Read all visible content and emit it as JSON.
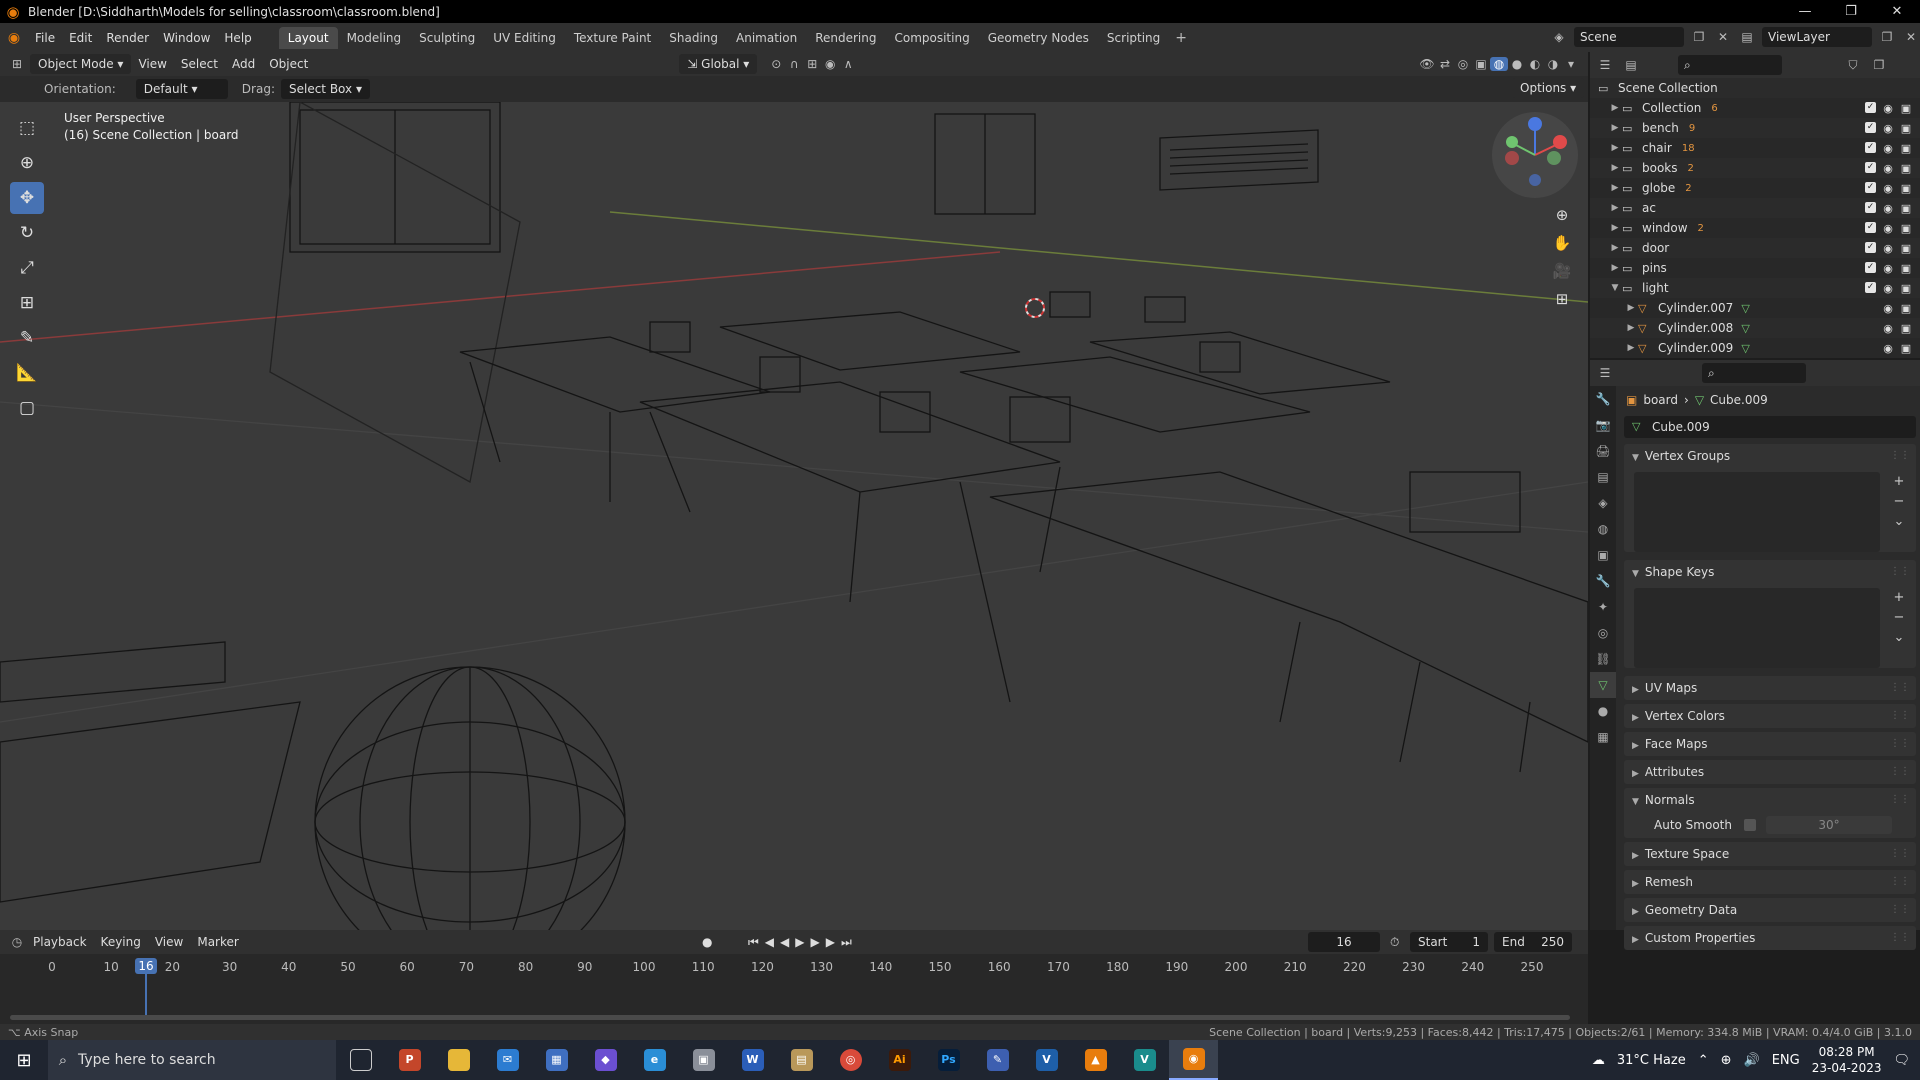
{
  "window": {
    "title": "Blender [D:\\Siddharth\\Models for selling\\classroom\\classroom.blend]"
  },
  "menus": [
    "File",
    "Edit",
    "Render",
    "Window",
    "Help"
  ],
  "workspaces": [
    "Layout",
    "Modeling",
    "Sculpting",
    "UV Editing",
    "Texture Paint",
    "Shading",
    "Animation",
    "Rendering",
    "Compositing",
    "Geometry Nodes",
    "Scripting"
  ],
  "active_workspace": "Layout",
  "scene_name": "Scene",
  "view_layer": "ViewLayer",
  "viewport_header": {
    "mode": "Object Mode",
    "menus": [
      "View",
      "Select",
      "Add",
      "Object"
    ],
    "transform_orientation": "Global"
  },
  "tool_header": {
    "orientation_label": "Orientation:",
    "orientation_value": "Default",
    "drag_label": "Drag:",
    "drag_value": "Select Box",
    "options": "Options"
  },
  "viewport_info": {
    "perspective": "User Perspective",
    "collection": "(16) Scene Collection | board"
  },
  "outliner": {
    "root": "Scene Collection",
    "rows": [
      {
        "label": "Collection",
        "count": "6",
        "type": "collection"
      },
      {
        "label": "bench",
        "count": "9",
        "type": "collection"
      },
      {
        "label": "chair",
        "count": "18",
        "type": "collection"
      },
      {
        "label": "books",
        "count": "2",
        "type": "collection"
      },
      {
        "label": "globe",
        "count": "2",
        "type": "collection"
      },
      {
        "label": "ac",
        "count": "",
        "type": "collection"
      },
      {
        "label": "window",
        "count": "2",
        "type": "collection"
      },
      {
        "label": "door",
        "count": "",
        "type": "collection"
      },
      {
        "label": "pins",
        "count": "",
        "type": "collection"
      },
      {
        "label": "light",
        "count": "",
        "type": "collection"
      },
      {
        "label": "Cylinder.007",
        "count": "",
        "type": "mesh"
      },
      {
        "label": "Cylinder.008",
        "count": "",
        "type": "mesh"
      },
      {
        "label": "Cylinder.009",
        "count": "",
        "type": "mesh"
      }
    ]
  },
  "properties": {
    "breadcrumb_object": "board",
    "breadcrumb_mesh": "Cube.009",
    "mesh_name": "Cube.009",
    "panels": {
      "vertex_groups": "Vertex Groups",
      "shape_keys": "Shape Keys",
      "uv_maps": "UV Maps",
      "vertex_colors": "Vertex Colors",
      "face_maps": "Face Maps",
      "attributes": "Attributes",
      "normals": "Normals",
      "texture_space": "Texture Space",
      "remesh": "Remesh",
      "geometry_data": "Geometry Data",
      "custom_properties": "Custom Properties"
    },
    "auto_smooth_label": "Auto Smooth",
    "auto_smooth_angle": "30°"
  },
  "timeline": {
    "menus": [
      "Playback",
      "Keying",
      "View",
      "Marker"
    ],
    "current_frame": "16",
    "start_label": "Start",
    "start": "1",
    "end_label": "End",
    "end": "250",
    "ticks": [
      "0",
      "10",
      "20",
      "30",
      "40",
      "50",
      "60",
      "70",
      "80",
      "90",
      "100",
      "110",
      "120",
      "130",
      "140",
      "150",
      "160",
      "170",
      "180",
      "190",
      "200",
      "210",
      "220",
      "230",
      "240",
      "250"
    ]
  },
  "status_bar": {
    "hint": "Axis Snap",
    "stats": "Scene Collection | board | Verts:9,253 | Faces:8,442 | Tris:17,475 | Objects:2/61 | Memory: 334.8 MiB | VRAM: 0.4/4.0 GiB | 3.1.0"
  },
  "taskbar": {
    "search_placeholder": "Type here to search",
    "weather": "31°C  Haze",
    "language": "ENG",
    "time": "08:28 PM",
    "date": "23-04-2023"
  },
  "colors": {
    "accent": "#4772b3",
    "blender_orange": "#e87d0d",
    "viewport_bg": "#3a3a3a",
    "panel_bg": "#2b2b2b"
  }
}
